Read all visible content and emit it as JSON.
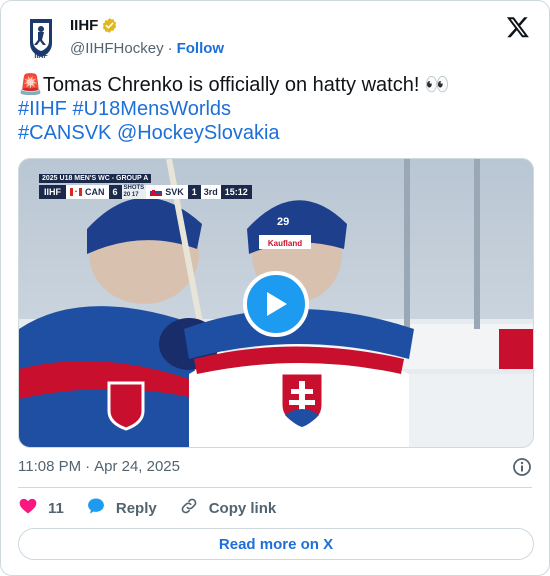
{
  "author": {
    "name": "IIHF",
    "handle": "@IIHFHockey",
    "separator": "·",
    "follow_label": "Follow"
  },
  "tweet": {
    "emoji_prefix": "🚨",
    "text_main": "Tomas Chrenko is officially on hatty watch! 👀",
    "hashtags_line1": [
      "#IIHF",
      "#U18MensWorlds"
    ],
    "line3": [
      "#CANSVK",
      "@HockeySlovakia"
    ]
  },
  "video": {
    "scorebug": {
      "title": "2025 U18 MEN'S WC - GROUP A",
      "org": "IIHF",
      "team1": "CAN",
      "score1": "6",
      "shots_label": "SHOTS",
      "shots": "20  17",
      "team2": "SVK",
      "score2": "1",
      "period": "3rd",
      "clock": "15:12"
    },
    "jersey_number": "29",
    "sponsor": "Kaufland"
  },
  "meta": {
    "time": "11:08 PM",
    "separator": "·",
    "date": "Apr 24, 2025"
  },
  "actions": {
    "like_count": "11",
    "reply_label": "Reply",
    "copy_label": "Copy link"
  },
  "read_more_label": "Read more on X",
  "colors": {
    "link": "#1d6fd9",
    "like": "#f91880",
    "reply": "#1d9bf0",
    "play": "#1d9bf0"
  }
}
